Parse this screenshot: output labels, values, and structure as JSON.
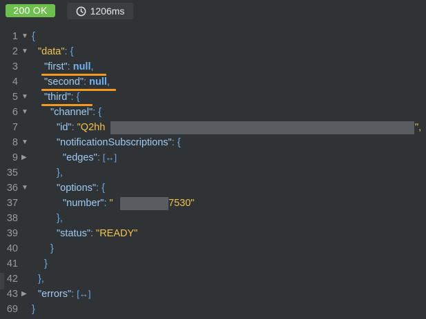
{
  "response": {
    "status": "200 OK",
    "time": "1206ms"
  },
  "lines": {
    "l1": {
      "n": "1",
      "open": "{"
    },
    "l2": {
      "n": "2",
      "key": "\"data\"",
      "colon": ": ",
      "open": "{"
    },
    "l3": {
      "n": "3",
      "key": "\"first\"",
      "colon": ": ",
      "val": "null",
      "comma": ","
    },
    "l4": {
      "n": "4",
      "key": "\"second\"",
      "colon": ": ",
      "val": "null",
      "comma": ","
    },
    "l5": {
      "n": "5",
      "key": "\"third\"",
      "colon": ": ",
      "open": "{"
    },
    "l6": {
      "n": "6",
      "key": "\"channel\"",
      "colon": ": ",
      "open": "{"
    },
    "l7": {
      "n": "7",
      "key": "\"id\"",
      "colon": ": ",
      "val_start": "\"Q2hh",
      "val_end": "\","
    },
    "l8": {
      "n": "8",
      "key": "\"notificationSubscriptions\"",
      "colon": ": ",
      "open": "{"
    },
    "l9": {
      "n": "9",
      "key": "\"edges\"",
      "colon": ": ",
      "collapsed": "[↔]"
    },
    "l35": {
      "n": "35",
      "close": "},"
    },
    "l36": {
      "n": "36",
      "key": "\"options\"",
      "colon": ": ",
      "open": "{"
    },
    "l37": {
      "n": "37",
      "key": "\"number\"",
      "colon": ": ",
      "val_start": "\"",
      "val_end": "7530\""
    },
    "l38": {
      "n": "38",
      "close": "},"
    },
    "l39": {
      "n": "39",
      "key": "\"status\"",
      "colon": ": ",
      "val": "\"READY\""
    },
    "l40": {
      "n": "40",
      "close": "}"
    },
    "l41": {
      "n": "41",
      "close": "}"
    },
    "l42": {
      "n": "42",
      "close": "},"
    },
    "l43": {
      "n": "43",
      "key": "\"errors\"",
      "colon": ": ",
      "collapsed": "[↔]"
    },
    "l69": {
      "n": "69",
      "close": "}"
    }
  },
  "colors": {
    "background": "#303336",
    "status_ok": "#6fbf4e",
    "string": "#f2c14e",
    "punctuation": "#6aa9e6",
    "highlight_underline": "#f29b23"
  },
  "icons": {
    "timer": "clock-icon",
    "fold_open": "caret-down-icon",
    "fold_closed": "caret-right-icon"
  }
}
